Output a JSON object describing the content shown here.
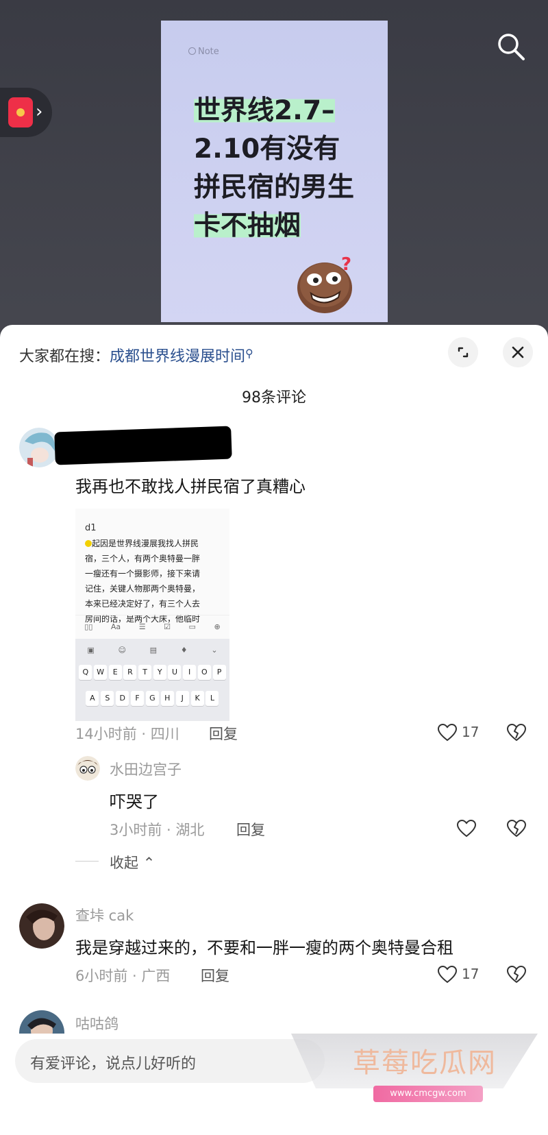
{
  "note": {
    "label": "Note",
    "title_lines": [
      "世界线2.7–",
      "2.10有没有",
      "拼民宿的男生",
      "卡不抽烟"
    ]
  },
  "top_bar": {
    "search_icon": "search-icon",
    "red_packet_icon": "red-envelope-icon"
  },
  "sheet": {
    "hot_search_prefix": "大家都在搜：",
    "hot_search_keyword": "成都世界线漫展时间",
    "comment_count": "98条评论"
  },
  "comments": [
    {
      "name": "",
      "text": "我再也不敢找人拼民宿了真糟心",
      "meta": "14小时前 · 四川",
      "reply_label": "回复",
      "likes": "17",
      "screenshot": {
        "header": "d1",
        "lines": [
          "起因是世界线漫展我找人拼民",
          "宿，三个人，有两个奥特曼一胖",
          "一瘦还有一个摄影师，接下来请",
          "记住，关键人物那两个奥特曼，",
          "本来已经决定好了，有三个人去",
          "房间的话，是两个大床，他临时"
        ],
        "toolbar": [
          "▯▯",
          "Aa",
          "☰",
          "☑",
          "▭",
          "⊕"
        ],
        "kb_row1": [
          "Q",
          "W",
          "E",
          "R",
          "T",
          "Y",
          "U",
          "I",
          "O",
          "P"
        ],
        "kb_row2": [
          "A",
          "S",
          "D",
          "F",
          "G",
          "H",
          "J",
          "K",
          "L"
        ]
      },
      "reply": {
        "name": "水田边宫子",
        "text": "吓哭了",
        "meta": "3小时前 · 湖北",
        "reply_label": "回复"
      },
      "collapse_label": "收起"
    },
    {
      "name": "查垰 cak",
      "text": "我是穿越过来的，不要和一胖一瘦的两个奥特曼合租",
      "meta": "6小时前 · 广西",
      "reply_label": "回复",
      "likes": "17"
    },
    {
      "name": "咕咕鸽"
    }
  ],
  "input": {
    "placeholder": "有爱评论，说点儿好听的"
  },
  "watermark": {
    "title": "草莓吃瓜网",
    "url": "www.cmcgw.com"
  }
}
